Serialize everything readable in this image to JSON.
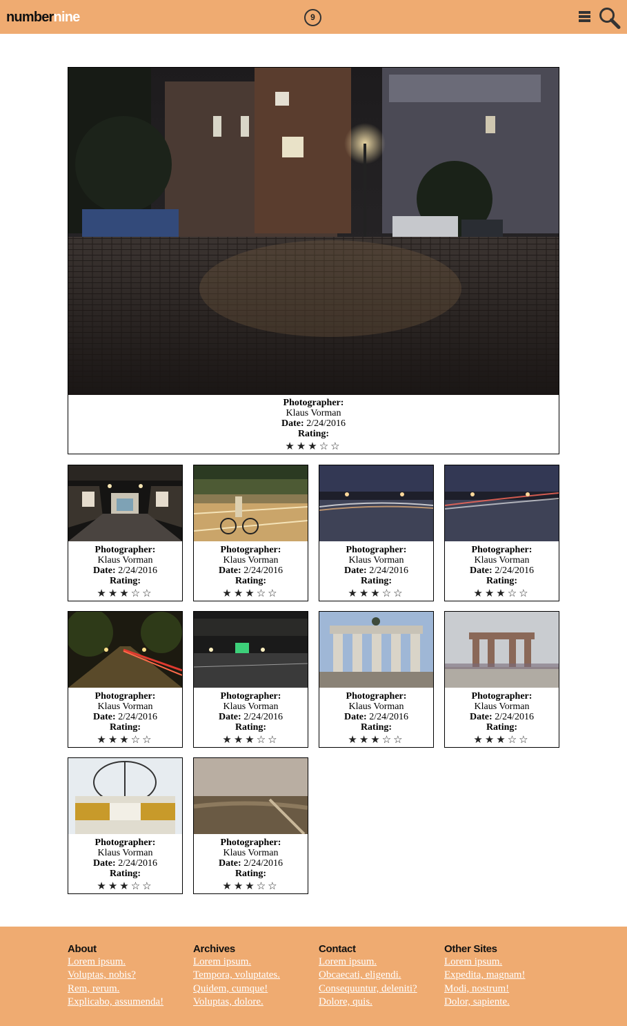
{
  "header": {
    "logo_part1": "number",
    "logo_part2": "nine",
    "badge": "9",
    "menu_icon": "hamburger-menu-icon",
    "search_icon": "magnifier-search-icon"
  },
  "colors": {
    "accent": "#efab71",
    "link": "#ffffff",
    "border": "#000000"
  },
  "labels": {
    "photographer": "Photographer:",
    "date": "Date:",
    "rating": "Rating:"
  },
  "featured": {
    "photographer": "Klaus Vorman",
    "date": "2/24/2016",
    "stars": "★★★☆☆",
    "rating": 3,
    "rating_max": 5
  },
  "photos": [
    {
      "photographer": "Klaus Vorman",
      "date": "2/24/2016",
      "stars": "★★★☆☆",
      "rating": 3
    },
    {
      "photographer": "Klaus Vorman",
      "date": "2/24/2016",
      "stars": "★★★☆☆",
      "rating": 3
    },
    {
      "photographer": "Klaus Vorman",
      "date": "2/24/2016",
      "stars": "★★★☆☆",
      "rating": 3
    },
    {
      "photographer": "Klaus Vorman",
      "date": "2/24/2016",
      "stars": "★★★☆☆",
      "rating": 3
    },
    {
      "photographer": "Klaus Vorman",
      "date": "2/24/2016",
      "stars": "★★★☆☆",
      "rating": 3
    },
    {
      "photographer": "Klaus Vorman",
      "date": "2/24/2016",
      "stars": "★★★☆☆",
      "rating": 3
    },
    {
      "photographer": "Klaus Vorman",
      "date": "2/24/2016",
      "stars": "★★★☆☆",
      "rating": 3
    },
    {
      "photographer": "Klaus Vorman",
      "date": "2/24/2016",
      "stars": "★★★☆☆",
      "rating": 3
    },
    {
      "photographer": "Klaus Vorman",
      "date": "2/24/2016",
      "stars": "★★★☆☆",
      "rating": 3
    },
    {
      "photographer": "Klaus Vorman",
      "date": "2/24/2016",
      "stars": "★★★☆☆",
      "rating": 3
    }
  ],
  "footer": {
    "columns": [
      {
        "title": "About",
        "links": [
          "Lorem ipsum.",
          "Voluptas, nobis?",
          "Rem, rerum.",
          "Explicabo, assumenda!"
        ]
      },
      {
        "title": "Archives",
        "links": [
          "Lorem ipsum.",
          "Tempora, voluptates.",
          "Quidem, cumque!",
          "Voluptas, dolore."
        ]
      },
      {
        "title": "Contact",
        "links": [
          "Lorem ipsum.",
          "Obcaecati, eligendi.",
          "Consequuntur, deleniti?",
          "Dolore, quis."
        ]
      },
      {
        "title": "Other Sites",
        "links": [
          "Lorem ipsum.",
          "Expedita, magnam!",
          "Modi, nostrum!",
          "Dolor, sapiente."
        ]
      }
    ]
  }
}
